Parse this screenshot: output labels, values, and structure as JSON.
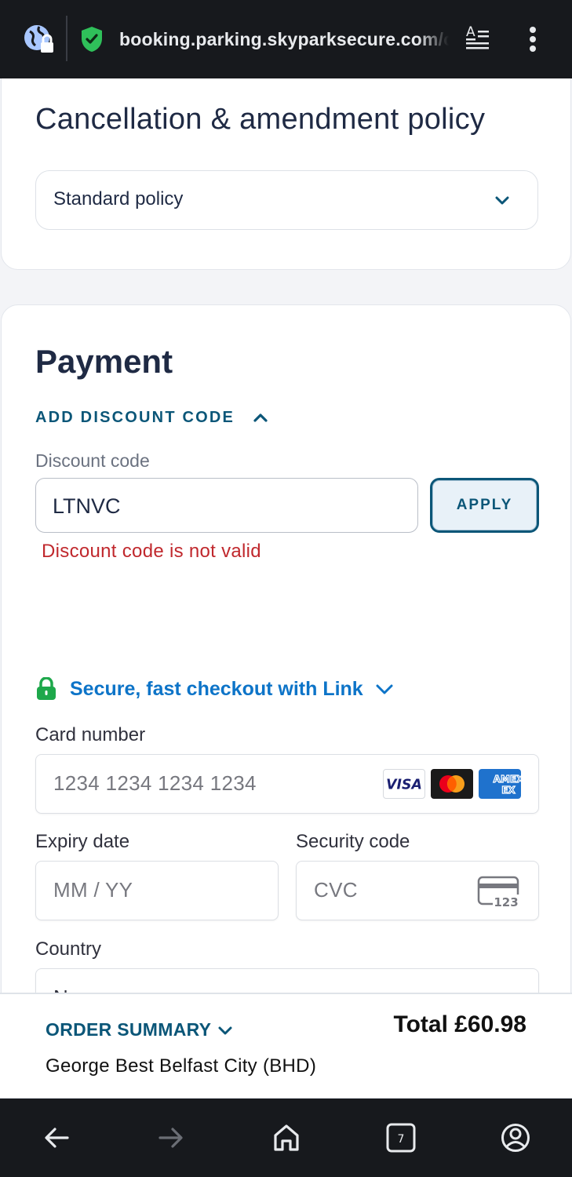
{
  "browser": {
    "url": "booking.parking.skyparksecure.com/c",
    "icons": [
      "site-info-icon",
      "verified-shield-icon",
      "reader-mode-icon",
      "more-menu-icon"
    ]
  },
  "cancellation": {
    "title": "Cancellation & amendment policy",
    "selected_policy": "Standard policy"
  },
  "payment": {
    "title": "Payment",
    "discount_toggle_label": "ADD DISCOUNT CODE",
    "discount_field_label": "Discount code",
    "discount_value": "LTNVC",
    "apply_label": "APPLY",
    "discount_error": "Discount code is not valid",
    "link_checkout_label": "Secure, fast checkout with Link",
    "card_number_label": "Card number",
    "card_number_placeholder": "1234 1234 1234 1234",
    "card_brands": [
      "VISA",
      "Mastercard",
      "AMEX"
    ],
    "expiry_label": "Expiry date",
    "expiry_placeholder": "MM / YY",
    "security_label": "Security code",
    "security_placeholder": "CVC",
    "cvc_icon_text": "123",
    "country_label": "Country",
    "country_value": "N"
  },
  "summary": {
    "toggle_label": "ORDER SUMMARY",
    "total": "Total £60.98",
    "airport": "George Best Belfast City (BHD)"
  },
  "navbar": {
    "tab_count": "7",
    "icons": [
      "back-icon",
      "forward-icon",
      "home-icon",
      "tabs-icon",
      "account-icon"
    ]
  },
  "colors": {
    "brand_teal": "#0b5678",
    "error_red": "#c0282d",
    "link_blue": "#0d74c8",
    "link_green": "#1ea84b",
    "chrome_dark": "#17191d"
  }
}
